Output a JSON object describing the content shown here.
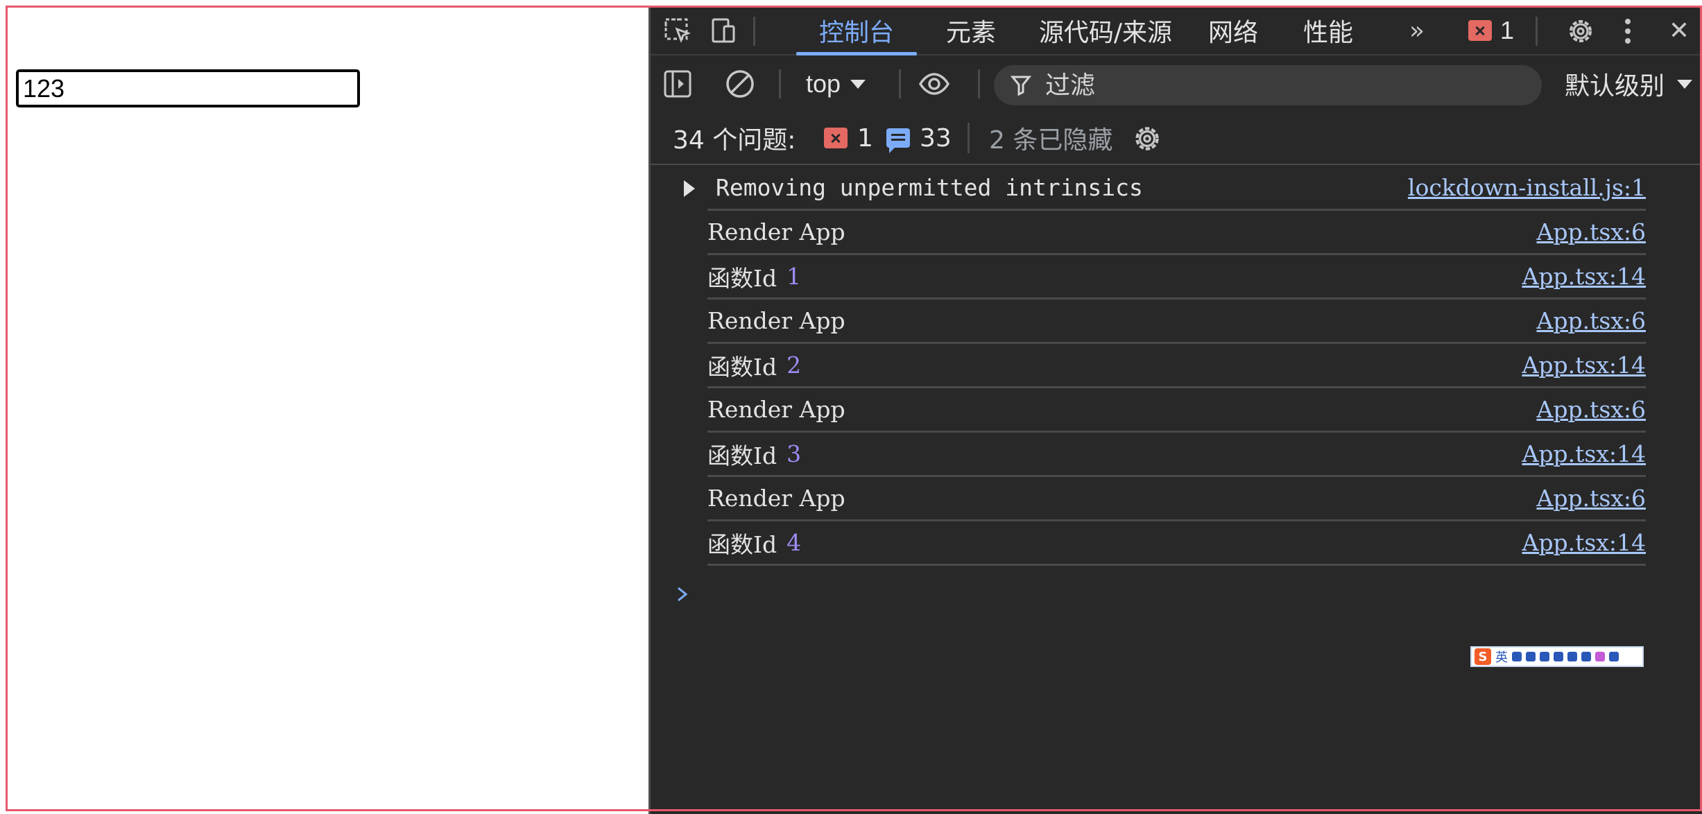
{
  "page": {
    "input_value": "123"
  },
  "devtools": {
    "toolbar": {
      "tabs": [
        "控制台",
        "元素",
        "源代码/来源",
        "网络",
        "性能"
      ],
      "active_tab": "控制台",
      "more_label": "»",
      "error_count": "1",
      "close_label": "✕"
    },
    "filterbar": {
      "context": "top",
      "filter_placeholder": "过滤",
      "level": "默认级别"
    },
    "issues": {
      "label": "34 个问题:",
      "errors": "1",
      "infos": "33",
      "hidden": "2 条已隐藏"
    },
    "console": {
      "rows": [
        {
          "text": "Removing unpermitted intrinsics",
          "num": "",
          "source": "lockdown-install.js:1"
        },
        {
          "text": "Render App",
          "num": "",
          "source": "App.tsx:6"
        },
        {
          "text": "函数Id",
          "num": "1",
          "source": "App.tsx:14"
        },
        {
          "text": "Render App",
          "num": "",
          "source": "App.tsx:6"
        },
        {
          "text": "函数Id",
          "num": "2",
          "source": "App.tsx:14"
        },
        {
          "text": "Render App",
          "num": "",
          "source": "App.tsx:6"
        },
        {
          "text": "函数Id",
          "num": "3",
          "source": "App.tsx:14"
        },
        {
          "text": "Render App",
          "num": "",
          "source": "App.tsx:6"
        },
        {
          "text": "函数Id",
          "num": "4",
          "source": "App.tsx:14"
        }
      ]
    },
    "ime": {
      "logo": "S",
      "mode": "英"
    },
    "colors": {
      "accent": "#7cacf8",
      "error": "#e46962",
      "number": "#9d8cf5",
      "link": "#a8c7fa",
      "frame": "#e8586d"
    }
  }
}
